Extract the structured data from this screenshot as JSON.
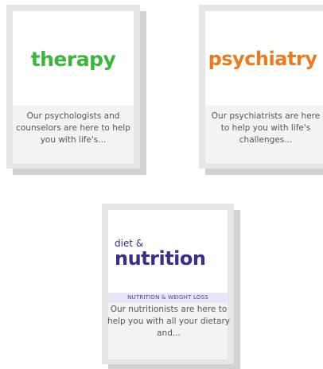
{
  "cards": {
    "therapy": {
      "brand": "therapy",
      "description": "Our psychologists and counselors are here to help you with life's..."
    },
    "psychiatry": {
      "brand": "psychiatry",
      "description": "Our psychiatrists are here to help you with life's challenges..."
    },
    "nutrition": {
      "brand_top": "diet &",
      "brand_main": "nutrition",
      "category": "NUTRITION & WEIGHT LOSS",
      "description": "Our nutritionists are here to help you with all your dietary and..."
    }
  },
  "colors": {
    "therapy_green": "#3ab63a",
    "psychiatry_orange": "#ee7a1e",
    "nutrition_purple": "#3d2c8c",
    "category_badge_bg": "#e9e6f7"
  }
}
